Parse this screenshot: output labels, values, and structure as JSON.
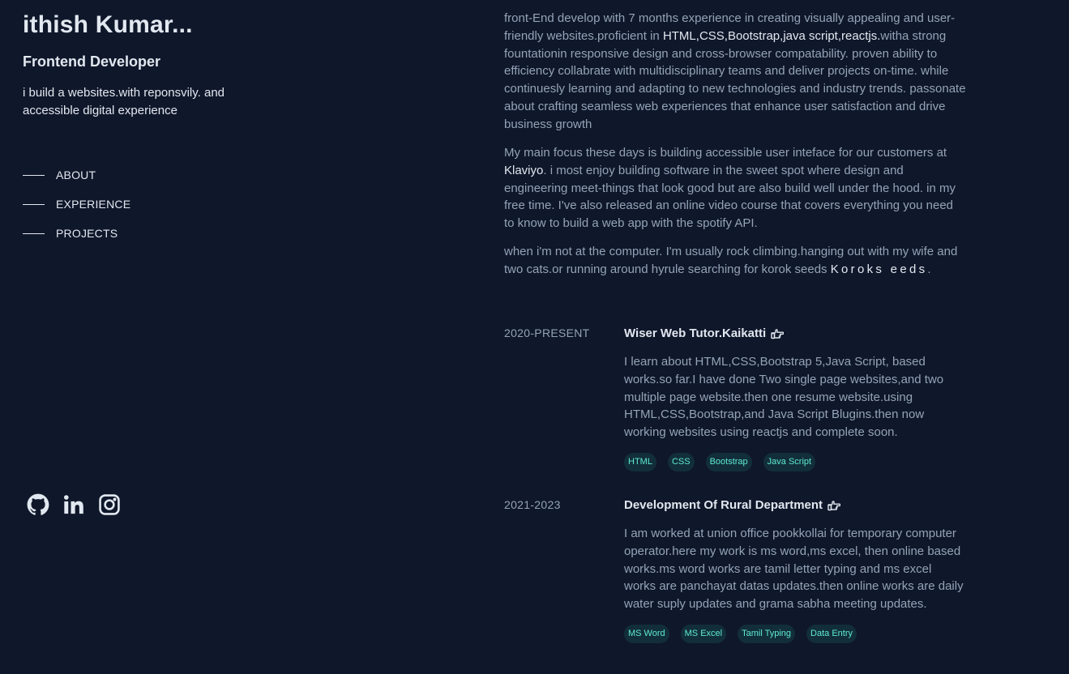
{
  "profile": {
    "name": "ithish Kumar...",
    "role": "Frontend Developer",
    "tagline": "i build a websites.with reponsvily. and accessible digital experience"
  },
  "nav": {
    "items": [
      {
        "label": "ABOUT"
      },
      {
        "label": "EXPERIENCE"
      },
      {
        "label": "PROJECTS"
      }
    ]
  },
  "socials": [
    {
      "icon": "github-icon"
    },
    {
      "icon": "linkedin-icon"
    },
    {
      "icon": "instagram-icon"
    }
  ],
  "about": {
    "p1_before": "front-End develop with 7 months experience in creating visually appealing and user-friendly websites.proficient in ",
    "p1_highlight": "HTML,CSS,Bootstrap,java script,reactjs.",
    "p1_after": "witha strong fountationin responsive design and cross-browser compatability. proven ability to efficiency collabrate with multidisciplinary teams and deliver projects on-time. while continuesly learning and adapting to new technologies and industry trends. passonate about crafting seamless web experiences that enhance user satisfaction and drive business growth",
    "p2_before": "My main focus these days is building accessible user inteface for our customers at ",
    "p2_highlight": "Klaviyo",
    "p2_after": ". i most enjoy building software in the sweet spot where design and engineering meet-things that look good but are also build well under the hood. in my free time. I've also released an online video course that covers everything you need to know to build a web app with the spotify API.",
    "p3_before": "when i'm not at the computer. I'm usually rock climbing.hanging out with my wife and two cats.or running around hyrule searching for korok seeds ",
    "p3_highlight": "Koroks eeds",
    "p3_after": "."
  },
  "experience": [
    {
      "date": "2020-PRESENT",
      "title": "Wiser Web Tutor.Kaikatti",
      "description": "I learn about HTML,CSS,Bootstrap 5,Java Script, based works.so far.I have done Two single page websites,and two multiple page website.then one resume website.using HTML,CSS,Bootstrap,and Java Script Blugins.then now working websites using reactjs and complete soon.",
      "tags": [
        "HTML",
        "CSS",
        "Bootstrap",
        "Java Script"
      ]
    },
    {
      "date": "2021-2023",
      "title": "Development Of Rural Department",
      "description": "I am worked at union office pookkollai for temporary computer operator.here my work is ms word,ms excel, then online based works.ms word works are tamil letter typing and ms excel works are panchayat datas updates.then online works are daily water suply updates and grama sabha meeting updates.",
      "tags": [
        "MS Word",
        "MS Excel",
        "Tamil Typing",
        "Data Entry"
      ]
    }
  ],
  "colors": {
    "background": "#0f172a",
    "heading": "#e2e8f0",
    "body_text": "#94a3b8",
    "tag_text": "#5eead4"
  }
}
